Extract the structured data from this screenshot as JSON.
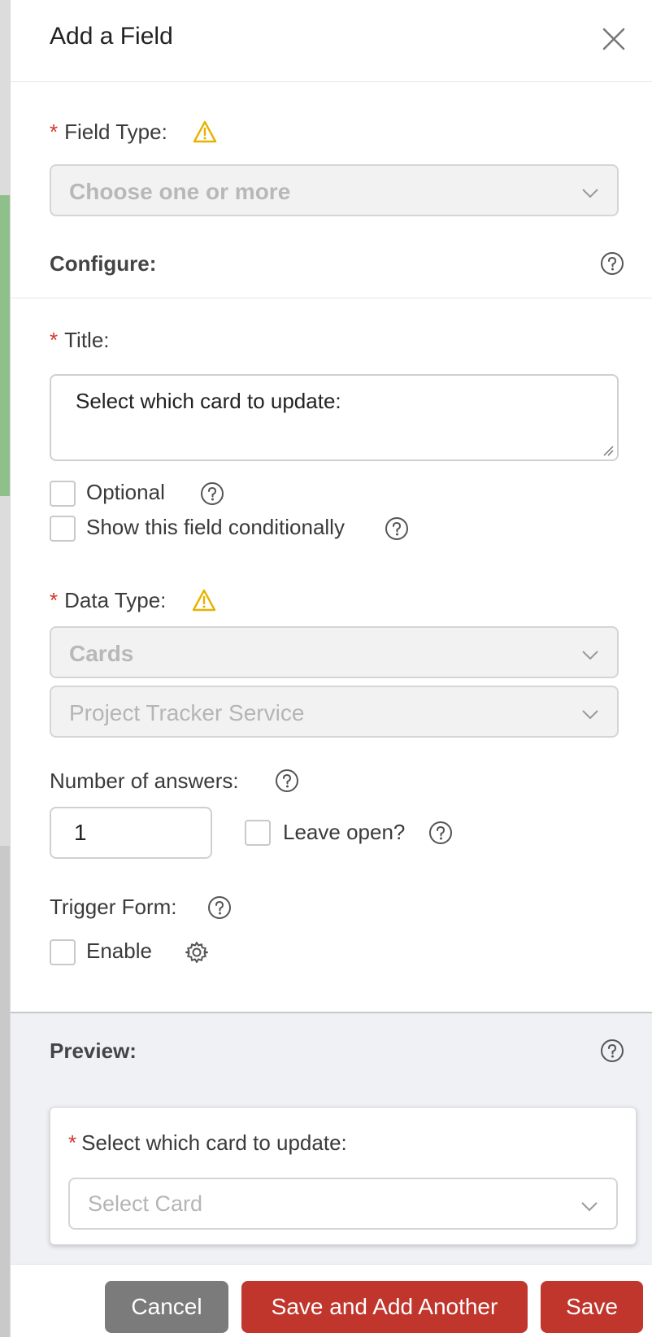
{
  "modal": {
    "title": "Add a Field"
  },
  "field_type": {
    "label": "Field Type:",
    "required_mark": "*",
    "placeholder": "Choose one or more"
  },
  "configure": {
    "label": "Configure:"
  },
  "title_field": {
    "label": "Title:",
    "required_mark": "*",
    "value": "Select which card to update:"
  },
  "options": {
    "optional_label": "Optional",
    "conditional_label": "Show this field conditionally"
  },
  "data_type": {
    "label": "Data Type:",
    "required_mark": "*",
    "primary_value": "Cards",
    "secondary_value": "Project Tracker Service"
  },
  "answers": {
    "label": "Number of answers:",
    "value": "1",
    "leave_open_label": "Leave open?"
  },
  "trigger_form": {
    "label": "Trigger Form:",
    "enable_label": "Enable"
  },
  "preview": {
    "label": "Preview:",
    "required_mark": "*",
    "question": "Select which card to update:",
    "select_placeholder": "Select Card"
  },
  "footer": {
    "cancel_label": "Cancel",
    "save_another_label": "Save and Add Another",
    "save_label": "Save"
  },
  "colors": {
    "required": "#d2372c",
    "warning": "#e8b100",
    "primary_button": "#c0362c",
    "secondary_button": "#7b7b7b"
  }
}
